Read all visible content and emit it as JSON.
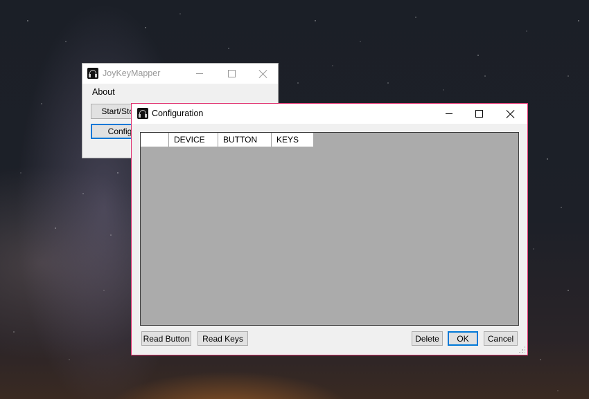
{
  "desktop": {
    "background": "night sky"
  },
  "main_window": {
    "title": "JoyKeyMapper",
    "menu": {
      "about": "About"
    },
    "buttons": {
      "start_stop": "Start/Stop",
      "config": "Config"
    }
  },
  "config_window": {
    "title": "Configuration",
    "columns": [
      "",
      "DEVICE",
      "BUTTON",
      "KEYS"
    ],
    "buttons": {
      "read_button": "Read Button",
      "read_keys": "Read Keys",
      "delete": "Delete",
      "ok": "OK",
      "cancel": "Cancel"
    }
  },
  "colors": {
    "accent": "#0078d7",
    "active_border": "#e0306e",
    "grid_bg": "#ababab"
  }
}
